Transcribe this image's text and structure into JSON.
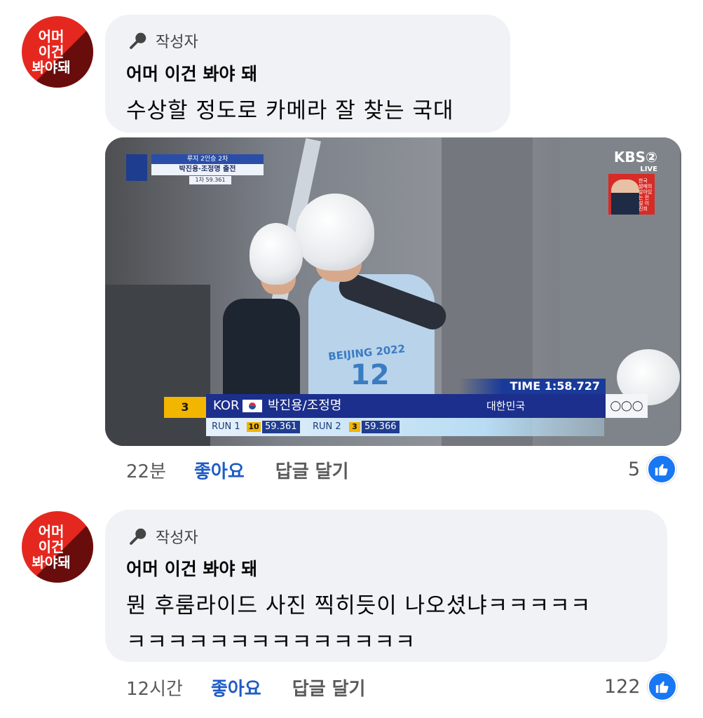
{
  "comments": [
    {
      "avatar_text": [
        "어머",
        "이건",
        "봐야돼"
      ],
      "author_badge": "작성자",
      "author_name": "어머 이건 봐야 돼",
      "text_lines": [
        "수상할 정도로 카메라 잘 찾는 국대"
      ],
      "time": "22분",
      "like_label": "좋아요",
      "reply_label": "답글 달기",
      "reaction_count": "5"
    },
    {
      "avatar_text": [
        "어머",
        "이건",
        "봐야돼"
      ],
      "author_badge": "작성자",
      "author_name": "어머 이건 봐야 돼",
      "text_lines": [
        "뭔 후룸라이드 사진 찍히듯이 나오셨냐ㅋㅋㅋㅋㅋ",
        "ㅋㅋㅋㅋㅋㅋㅋㅋㅋㅋㅋㅋㅋㅋ"
      ],
      "time": "12시간",
      "like_label": "좋아요",
      "reply_label": "답글 달기",
      "reaction_count": "122"
    }
  ],
  "broadcast": {
    "channel": "KBS②",
    "live": "LIVE",
    "event_title": "루지 2인승 2차",
    "athletes_header": "박진용·조정명 출전",
    "run1_header": "1차 59.361",
    "time_label": "TIME 1:58.727",
    "rank": "3",
    "country_code": "KOR",
    "athletes": "박진용/조정명",
    "country_name": "대한민국",
    "run1_label": "RUN 1",
    "run1_rank": "10",
    "run1_time": "59.361",
    "run2_label": "RUN 2",
    "run2_rank": "3",
    "run2_time": "59.366",
    "bib": "12",
    "suit_text": "BEIJING 2022",
    "anchor_caption": "한국 썰매의 살아있는 전설 이진희"
  },
  "colors": {
    "like_blue": "#1e5bc6",
    "avatar_red": "#e5281f",
    "bubble_gray": "#f0f2f5",
    "reaction_blue": "#1877f2"
  }
}
